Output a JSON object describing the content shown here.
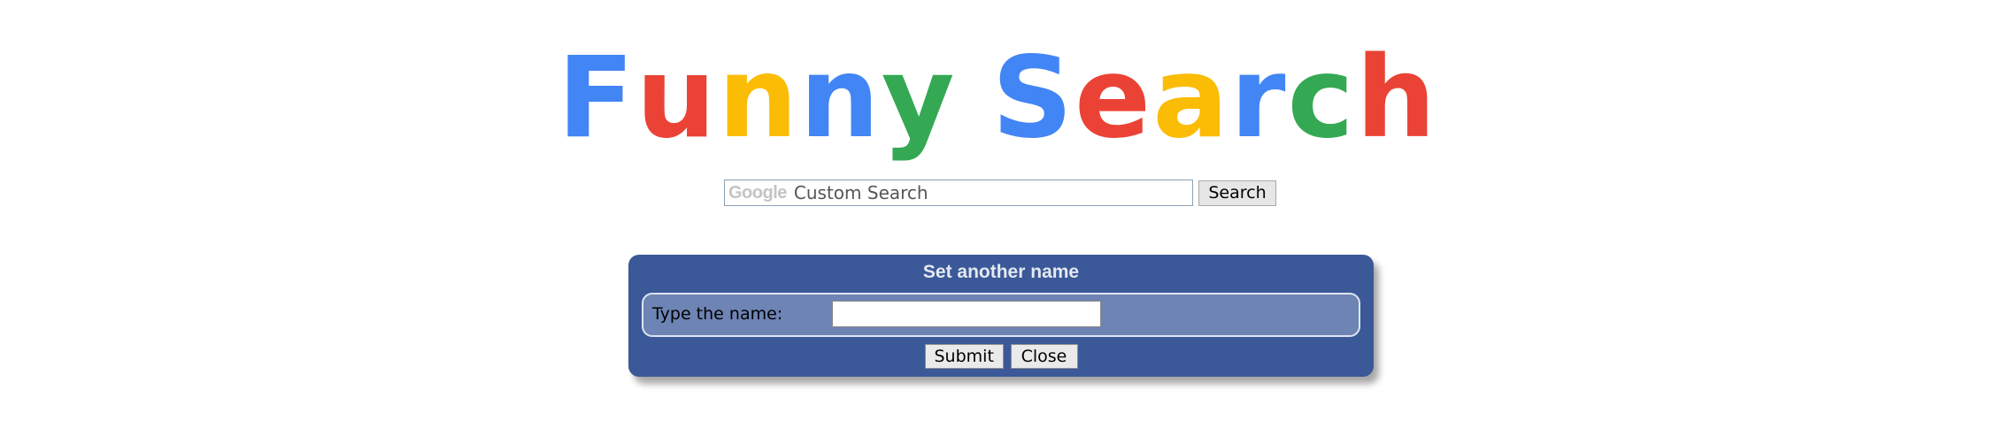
{
  "logo": {
    "letters": [
      {
        "char": "F",
        "color": "#4285f4"
      },
      {
        "char": "u",
        "color": "#ea4335"
      },
      {
        "char": "n",
        "color": "#fbbc05"
      },
      {
        "char": "n",
        "color": "#4285f4"
      },
      {
        "char": "y",
        "color": "#34a853"
      },
      {
        "char": " ",
        "color": "#ffffff"
      },
      {
        "char": "S",
        "color": "#4285f4"
      },
      {
        "char": "e",
        "color": "#ea4335"
      },
      {
        "char": "a",
        "color": "#fbbc05"
      },
      {
        "char": "r",
        "color": "#4285f4"
      },
      {
        "char": "c",
        "color": "#34a853"
      },
      {
        "char": "h",
        "color": "#ea4335"
      }
    ]
  },
  "search": {
    "brand": "Google",
    "placeholder": "Custom Search",
    "value": "",
    "button_label": "Search"
  },
  "dialog": {
    "title": "Set another name",
    "field_label": "Type the name:",
    "field_value": "",
    "submit_label": "Submit",
    "close_label": "Close",
    "background_color": "#3b5998",
    "panel_color": "#6d84b4"
  }
}
